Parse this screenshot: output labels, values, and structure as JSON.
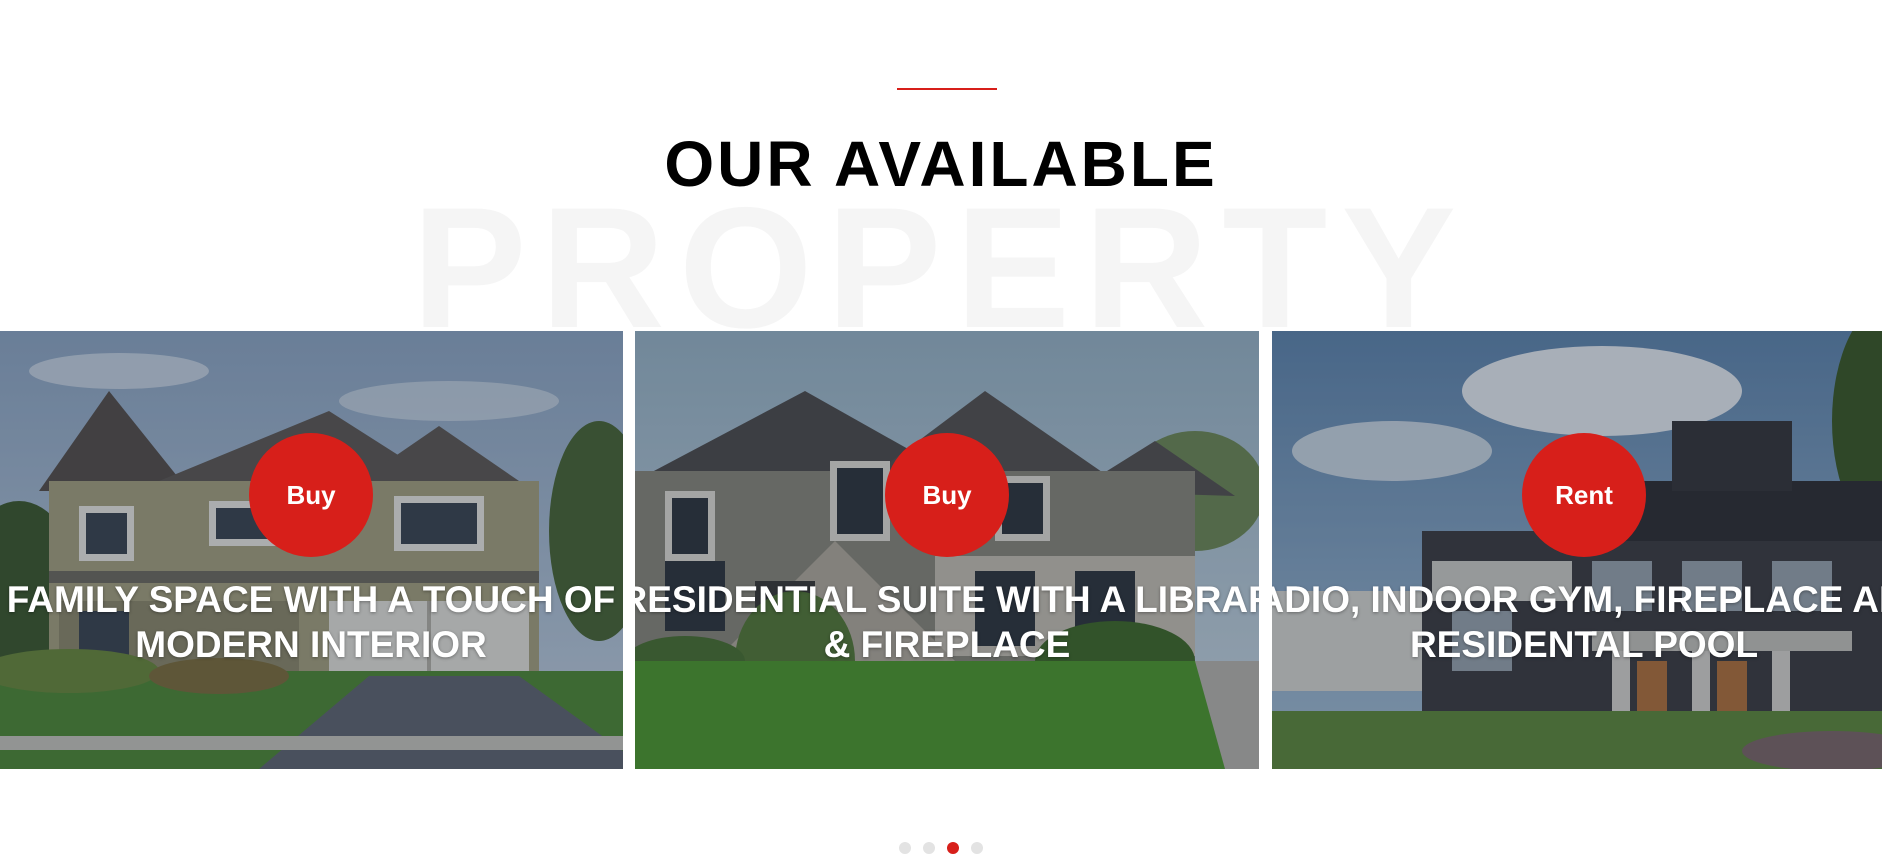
{
  "colors": {
    "accent": "#d71f1a",
    "title": "#000000",
    "watermark": "#f5f5f5",
    "overlay": "rgba(20,30,50,0.30)"
  },
  "section": {
    "title": "OUR AVAILABLE",
    "watermark": "PROPERTY"
  },
  "cards": [
    {
      "badge": "Buy",
      "title": "FAMILY SPACE WITH A TOUCH OF MODERN INTERIOR"
    },
    {
      "badge": "Buy",
      "title": "PRESIDENTIAL SUITE WITH A LIBRARY & FIREPLACE"
    },
    {
      "badge": "Rent",
      "title": "PADIO, INDOOR GYM, FIREPLACE AND RESIDENTAL POOL"
    }
  ],
  "pagination": {
    "count": 4,
    "active_index": 2
  }
}
